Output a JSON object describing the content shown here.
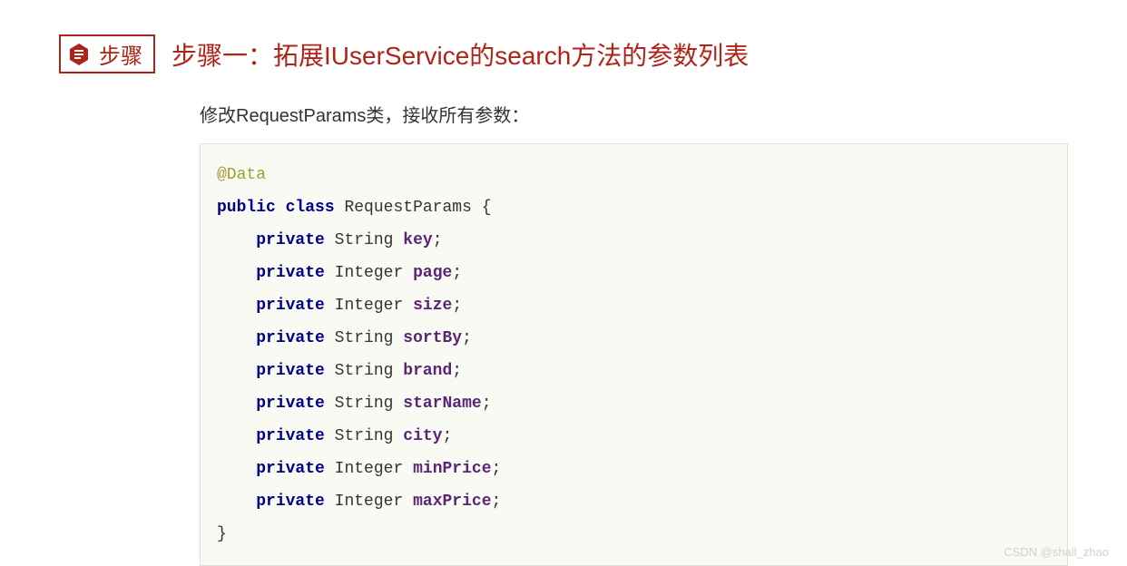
{
  "badge": {
    "label": "步骤"
  },
  "step": {
    "title": "步骤一：拓展IUserService的search方法的参数列表"
  },
  "description": "修改RequestParams类，接收所有参数：",
  "code": {
    "annotation": "@Data",
    "kw_public": "public",
    "kw_class": "class",
    "class_name": "RequestParams",
    "brace_open": " {",
    "kw_private": "private",
    "fields": [
      {
        "type": "String",
        "name": "key"
      },
      {
        "type": "Integer",
        "name": "page"
      },
      {
        "type": "Integer",
        "name": "size"
      },
      {
        "type": "String",
        "name": "sortBy"
      },
      {
        "type": "String",
        "name": "brand"
      },
      {
        "type": "String",
        "name": "starName"
      },
      {
        "type": "String",
        "name": "city"
      },
      {
        "type": "Integer",
        "name": "minPrice"
      },
      {
        "type": "Integer",
        "name": "maxPrice"
      }
    ],
    "brace_close": "}"
  },
  "watermark": "CSDN @shall_zhao"
}
